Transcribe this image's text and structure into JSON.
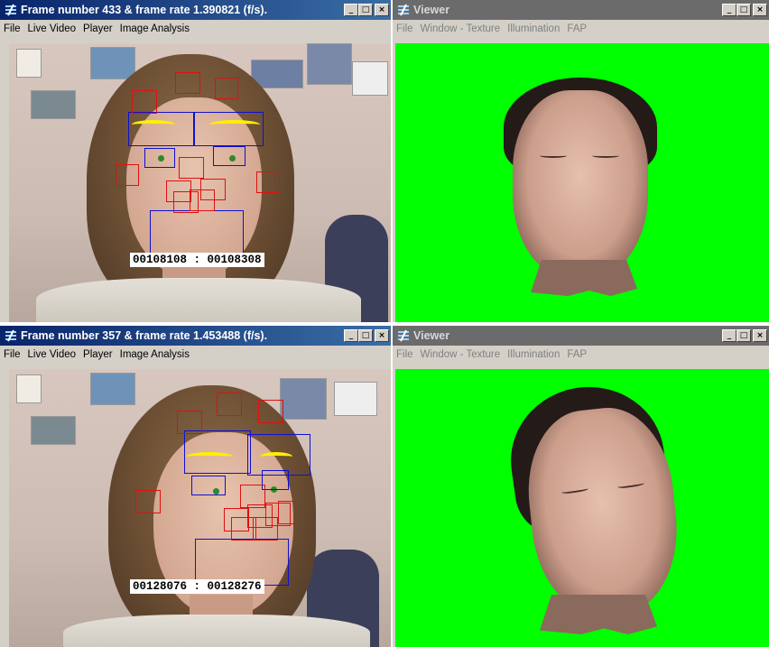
{
  "windows": {
    "tracker_top": {
      "title": "Frame number 433 & frame rate 1.390821 (f/s).",
      "menu": [
        "File",
        "Live Video",
        "Player",
        "Image Analysis"
      ],
      "timecode": "00108108 : 00108308"
    },
    "viewer_top": {
      "title": "Viewer",
      "menu": [
        "File",
        "Window - Texture",
        "Illumination",
        "FAP"
      ]
    },
    "tracker_bottom": {
      "title": "Frame number 357 & frame rate 1.453488 (f/s).",
      "menu": [
        "File",
        "Live Video",
        "Player",
        "Image Analysis"
      ],
      "timecode": "00128076 : 00128276"
    },
    "viewer_bottom": {
      "title": "Viewer",
      "menu": [
        "File",
        "Window - Texture",
        "Illumination",
        "FAP"
      ]
    }
  },
  "controls": {
    "minimize": "_",
    "maximize": "□",
    "close": "×"
  },
  "colors": {
    "title_active": "#0a246a",
    "title_inactive": "#6b6b6b",
    "viewer_background": "#00ff00",
    "feature_box_red": "#e01010",
    "feature_box_blue": "#1010d0",
    "eyebrow_contour": "#ffef00"
  }
}
